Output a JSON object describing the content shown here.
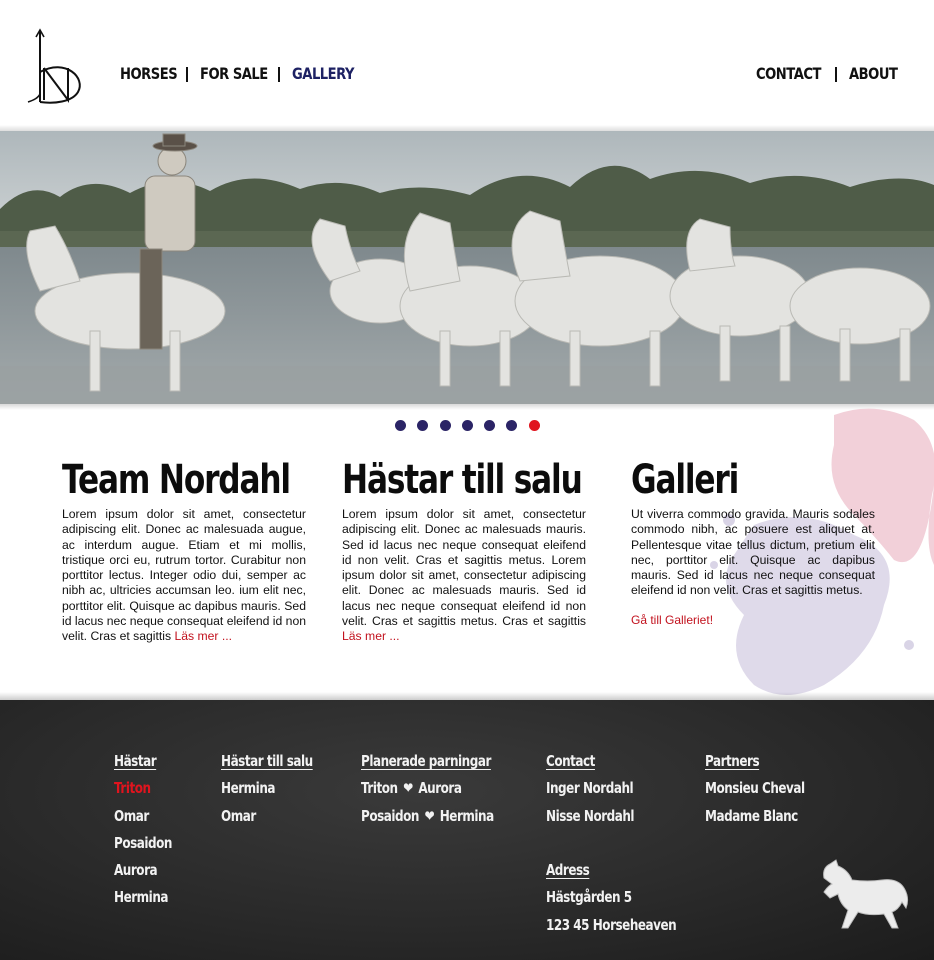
{
  "header": {
    "nav_left": [
      {
        "label": "HORSES",
        "active": false
      },
      {
        "label": "FOR SALE",
        "active": false
      },
      {
        "label": "GALLERY",
        "active": true
      }
    ],
    "nav_right": [
      {
        "label": "CONTACT"
      },
      {
        "label": "ABOUT"
      }
    ]
  },
  "slider": {
    "slide_count": 7,
    "active_index": 6,
    "dot_color": "#2b2466",
    "active_dot_color": "#e0141e"
  },
  "columns": [
    {
      "title": "Team Nordahl",
      "body": "Lorem ipsum dolor sit amet, consectetur adipiscing elit. Donec ac malesuada augue, ac interdum augue. Etiam et mi mollis, tristique orci eu, rutrum tortor. Curabitur non porttitor lectus. Integer odio dui, semper ac nibh ac, ultricies accumsan leo. ium elit nec, porttitor elit. Quisque ac dapibus mauris. Sed id lacus nec neque consequat eleifend id non velit. Cras et sagittis ",
      "link": "Läs mer ..."
    },
    {
      "title": "Hästar till salu",
      "body": "Lorem ipsum dolor sit amet, consectetur adipiscing elit. Donec ac malesuads mauris. Sed id lacus nec neque consequat eleifend id non velit. Cras et sagittis metus. Lorem ipsum dolor sit amet, consectetur adipiscing elit. Donec ac malesuads mauris. Sed id lacus nec neque  consequat eleifend id non velit. Cras et sagittis metus. Cras et sagittis ",
      "link": "Läs mer ..."
    },
    {
      "title": "Galleri",
      "body": "Ut viverra commodo gravida. Mauris sodales commodo nibh, ac posuere est aliquet at. Pellentesque vitae tellus dictum, pretium elit nec, porttitor elit. Quisque ac dapibus mauris. Sed id lacus nec neque consequat eleifend id non velit. Cras et sagittis metus.",
      "link": "Gå till Galleriet!"
    }
  ],
  "footer": {
    "horses": {
      "heading": "Hästar",
      "items": [
        "Triton",
        "Omar",
        "Posaidon",
        "Aurora",
        "Hermina"
      ],
      "active_index": 0
    },
    "for_sale": {
      "heading": "Hästar till salu",
      "items": [
        "Hermina",
        "Omar"
      ]
    },
    "matings": {
      "heading": "Planerade parningar",
      "pairs": [
        [
          "Triton",
          "Aurora"
        ],
        [
          "Posaidon",
          "Hermina"
        ]
      ],
      "heart_icon": "heart-icon"
    },
    "contact": {
      "heading": "Contact",
      "items": [
        "Inger Nordahl",
        "Nisse Nordahl"
      ]
    },
    "address": {
      "heading": "Adress",
      "lines": [
        "Hästgården 5",
        "123 45 Horseheaven"
      ]
    },
    "partners": {
      "heading": "Partners",
      "items": [
        "Monsieu Cheval",
        "Madame Blanc"
      ]
    }
  },
  "icons": {
    "logo": "nordahl-logo-icon",
    "footer_mark": "running-horse-icon"
  },
  "colors": {
    "accent_red": "#c2121e",
    "active_nav": "#1d2163",
    "footer_bg": "#2a2a2a",
    "splash_pink": "#f0c8d2",
    "splash_lilac": "#d9d4e6"
  }
}
